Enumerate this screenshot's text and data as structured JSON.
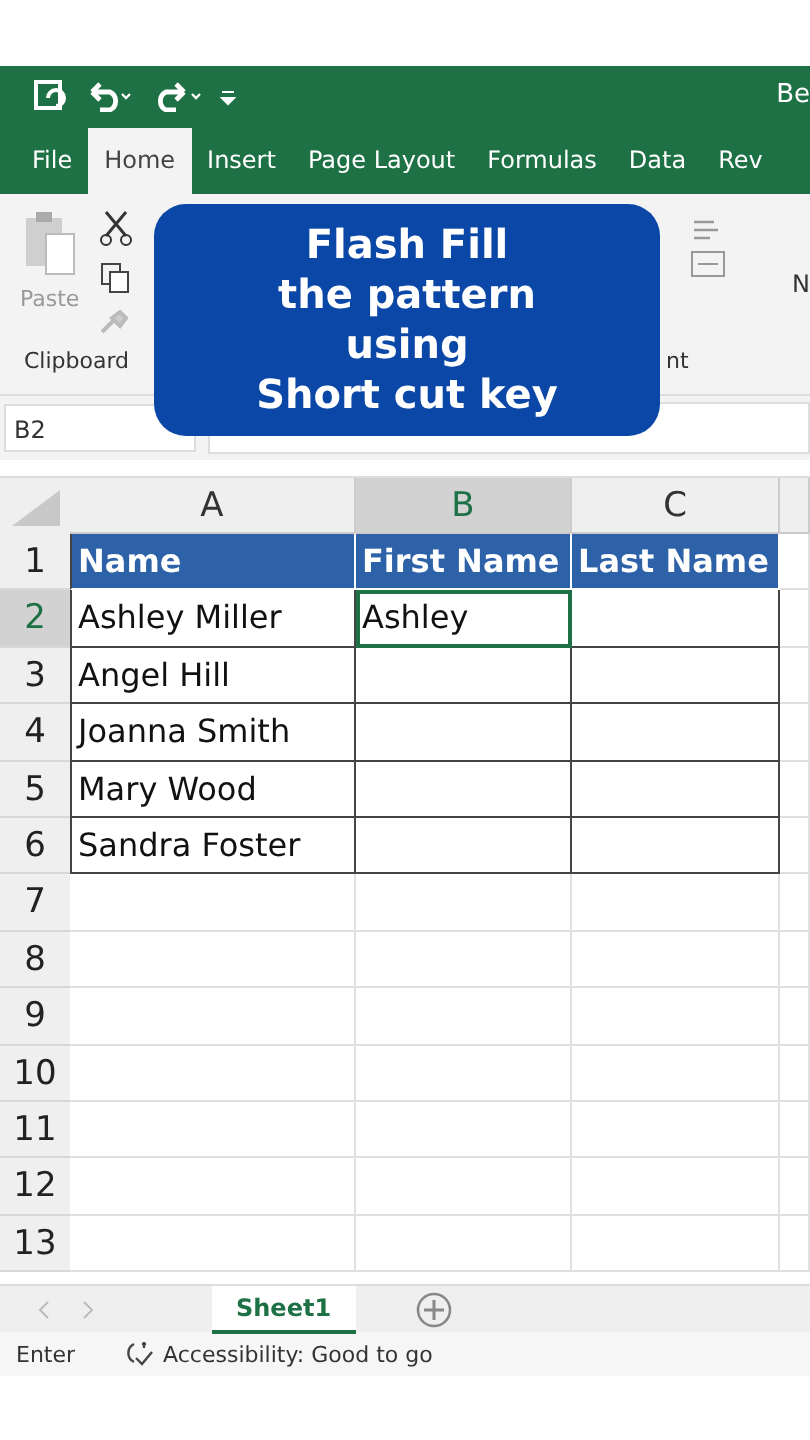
{
  "title_bar": {
    "title": "Be"
  },
  "ribbon_tabs": [
    {
      "label": "File",
      "selected": false
    },
    {
      "label": "Home",
      "selected": true
    },
    {
      "label": "Insert",
      "selected": false
    },
    {
      "label": "Page Layout",
      "selected": false
    },
    {
      "label": "Formulas",
      "selected": false
    },
    {
      "label": "Data",
      "selected": false
    },
    {
      "label": "Rev",
      "selected": false
    }
  ],
  "ribbon": {
    "paste_label": "Paste",
    "clipboard_label": "Clipboard",
    "group_label_cut": "nt",
    "number_label_cut": "N"
  },
  "banner": {
    "lines": [
      "Flash Fill",
      "the pattern",
      "using",
      "Short cut key"
    ]
  },
  "name_box": "B2",
  "columns": [
    {
      "label": "A",
      "selected": false
    },
    {
      "label": "B",
      "selected": true
    },
    {
      "label": "C",
      "selected": false
    }
  ],
  "rows": [
    {
      "number": "1",
      "selected": false,
      "kind": "header",
      "cells": [
        {
          "text": "Name",
          "active": false
        },
        {
          "text": "First Name",
          "active": false
        },
        {
          "text": "Last Name",
          "active": false
        }
      ]
    },
    {
      "number": "2",
      "selected": true,
      "kind": "data",
      "cells": [
        {
          "text": "Ashley Miller",
          "active": false
        },
        {
          "text": "Ashley",
          "active": true
        },
        {
          "active": false
        }
      ]
    },
    {
      "number": "3",
      "selected": false,
      "kind": "data",
      "cells": [
        {
          "text": "Angel Hill",
          "active": false
        },
        {
          "active": false
        },
        {
          "active": false
        }
      ]
    },
    {
      "number": "4",
      "selected": false,
      "kind": "data",
      "cells": [
        {
          "text": "Joanna Smith",
          "active": false
        },
        {
          "active": false
        },
        {
          "active": false
        }
      ]
    },
    {
      "number": "5",
      "selected": false,
      "kind": "data",
      "cells": [
        {
          "text": "Mary Wood",
          "active": false
        },
        {
          "active": false
        },
        {
          "active": false
        }
      ]
    },
    {
      "number": "6",
      "selected": false,
      "kind": "data",
      "cells": [
        {
          "text": "Sandra Foster",
          "active": false
        },
        {
          "active": false
        },
        {
          "active": false
        }
      ]
    },
    {
      "number": "7",
      "selected": false,
      "kind": "empty",
      "cells": []
    },
    {
      "number": "8",
      "selected": false,
      "kind": "empty",
      "cells": []
    },
    {
      "number": "9",
      "selected": false,
      "kind": "empty",
      "cells": []
    },
    {
      "number": "10",
      "selected": false,
      "kind": "empty",
      "cells": []
    },
    {
      "number": "11",
      "selected": false,
      "kind": "empty",
      "cells": []
    },
    {
      "number": "12",
      "selected": false,
      "kind": "empty",
      "cells": []
    },
    {
      "number": "13",
      "selected": false,
      "kind": "empty",
      "cells": []
    }
  ],
  "sheet_tabs": [
    {
      "label": "Sheet1",
      "selected": true
    }
  ],
  "status_bar": {
    "mode": "Enter",
    "accessibility": "Accessibility: Good to go"
  }
}
